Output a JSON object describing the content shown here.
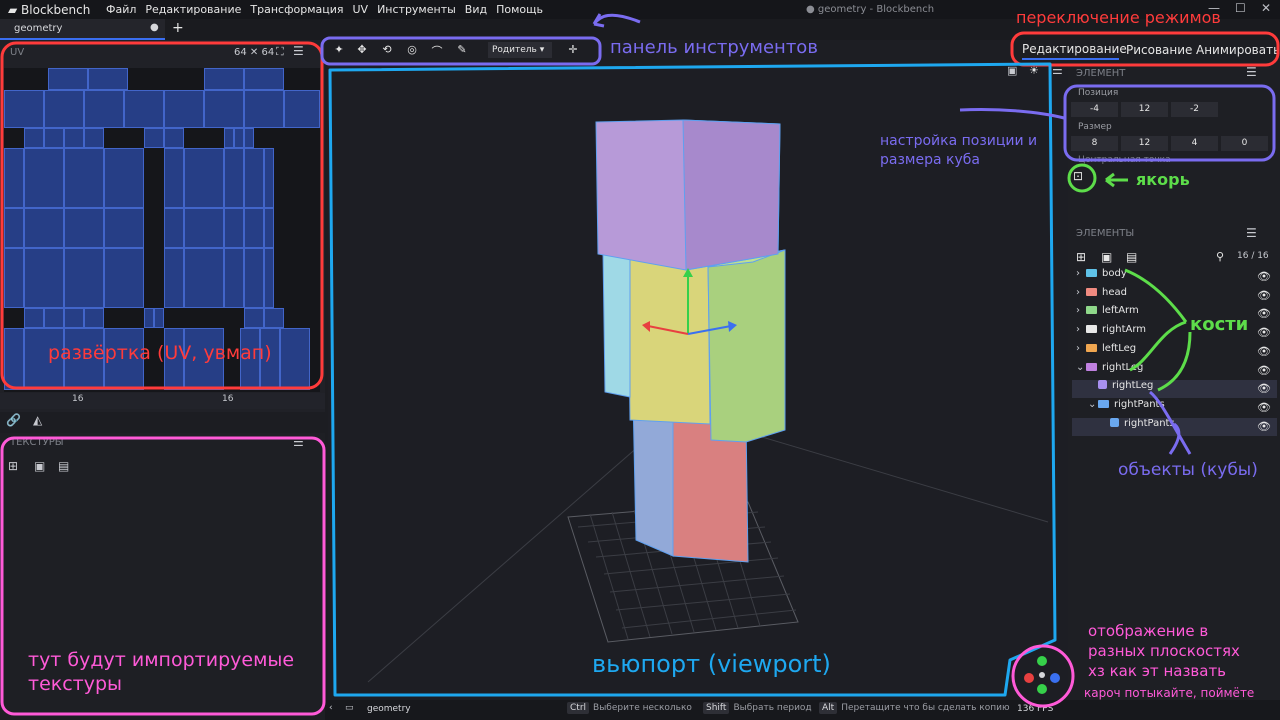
{
  "app": {
    "name": "Blockbench",
    "menu": [
      "Файл",
      "Редактирование",
      "Трансформация",
      "UV",
      "Инструменты",
      "Вид",
      "Помощь"
    ],
    "window_title": "● geometry - Blockbench",
    "window_controls": [
      "—",
      "☐",
      "✕"
    ]
  },
  "tabs": [
    {
      "label": "geometry",
      "modified_mark": "●"
    }
  ],
  "add_tab": "+",
  "uv_panel": {
    "title": "UV",
    "size": "64 ✕ 64",
    "footer_values": [
      "16",
      "16"
    ]
  },
  "textures_panel": {
    "title": "ТЕКСТУРЫ"
  },
  "toolbar": {
    "parent_select": "Родитель"
  },
  "modes": [
    "Редактирование",
    "Рисование",
    "Анимировать"
  ],
  "element_panel": {
    "title": "ЭЛЕМЕНТ",
    "position_label": "Позиция",
    "position": [
      "-4",
      "12",
      "-2"
    ],
    "size_label": "Размер",
    "size": [
      "8",
      "12",
      "4",
      "0"
    ],
    "pivot_label": "Центральная точка"
  },
  "outliner": {
    "title": "ЭЛЕМЕНТЫ",
    "count": "16 / 16",
    "items": [
      {
        "label": "body",
        "color": "#5fc2e8",
        "arrow": "›",
        "indent": 0
      },
      {
        "label": "head",
        "color": "#f08a80",
        "arrow": "›",
        "indent": 0
      },
      {
        "label": "leftArm",
        "color": "#8fd88a",
        "arrow": "›",
        "indent": 0
      },
      {
        "label": "rightArm",
        "color": "#e8e8e8",
        "arrow": "›",
        "indent": 0
      },
      {
        "label": "leftLeg",
        "color": "#f0a650",
        "arrow": "›",
        "indent": 0
      },
      {
        "label": "rightLeg",
        "color": "#c080e0",
        "arrow": "⌄",
        "indent": 0
      },
      {
        "label": "rightLeg",
        "color": "#a890f0",
        "arrow": "",
        "indent": 1,
        "cube": true,
        "selected": true
      },
      {
        "label": "rightPants",
        "color": "#6aa8f0",
        "arrow": "⌄",
        "indent": 1
      },
      {
        "label": "rightPants",
        "color": "#6aa8f0",
        "arrow": "",
        "indent": 2,
        "cube": true,
        "selected": true
      }
    ]
  },
  "status": {
    "file": "geometry",
    "hints": [
      {
        "key": "Ctrl",
        "text": "Выберите несколько"
      },
      {
        "key": "Shift",
        "text": "Выбрать период"
      },
      {
        "key": "Alt",
        "text": "Перетащите что бы сделать копию"
      }
    ],
    "fps": "136 FPS"
  },
  "annotations": {
    "toolbar": "панель инструментов",
    "modes": "переключение режимов",
    "uv": "развёртка (UV, увмап)",
    "textures": "тут будут импортируемые текстуры",
    "viewport": "вьюпорт (viewport)",
    "position_size": "настройка позиции и размера куба",
    "anchor": "якорь",
    "bones": "кости",
    "objects": "объекты (кубы)",
    "gizmo_1": "отображение в",
    "gizmo_2": "разных плоскостях",
    "gizmo_3": "хз как эт назвать",
    "gizmo_4": "кароч потыкайте, поймёте"
  },
  "colors": {
    "uv_annot": "#ff3b3b",
    "tool_annot": "#7a6cf0",
    "viewport_annot": "#1ea8f0",
    "pink_annot": "#ff5ad8",
    "green_annot": "#5ddd4a"
  }
}
